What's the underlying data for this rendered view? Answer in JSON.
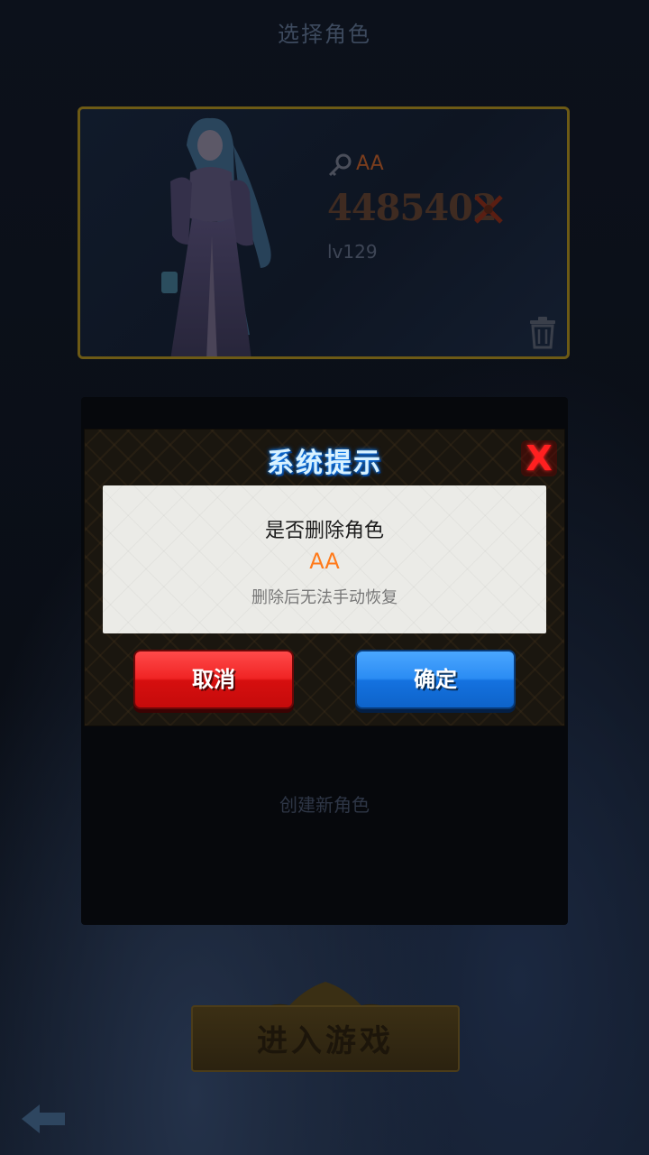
{
  "screen": {
    "title": "选择角色"
  },
  "character": {
    "name": "AA",
    "power": "4485402",
    "level": "lv129"
  },
  "slot2": {
    "label": "创建新角色"
  },
  "enter_game": {
    "label": "进入游戏"
  },
  "dialog": {
    "title": "系统提示",
    "close_label": "X",
    "question": "是否删除角色",
    "character_name": "AA",
    "warning": "删除后无法手动恢复",
    "cancel_label": "取消",
    "confirm_label": "确定"
  },
  "colors": {
    "cancel_button": "#f02424",
    "confirm_button": "#2b8cf3",
    "character_name_highlight": "#ff7a1a",
    "dialog_title": "#d9f2ff",
    "card_border": "#6d5a15"
  },
  "icons": [
    "key-icon",
    "crossed-swords-icon",
    "trash-icon",
    "back-arrow-icon",
    "close-icon"
  ]
}
